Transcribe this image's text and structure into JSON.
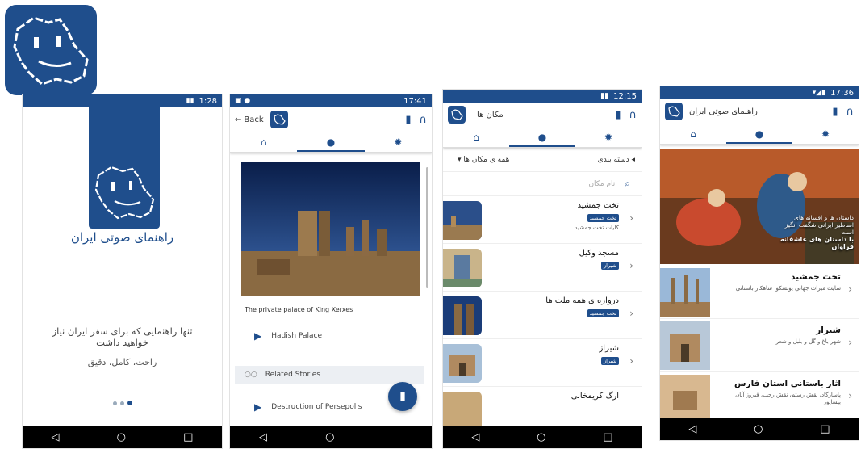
{
  "screen1": {
    "time": "1:28",
    "title": "راهنمای صوتی ایران",
    "subtitle": "تنها راهنمایی که برای سفر ایران نیاز خواهید داشت",
    "tagline": "راحت، کامل، دقیق"
  },
  "screen2": {
    "time": "17:41",
    "back_label": "Back",
    "caption": "The private palace of King Xerxes",
    "audio1": "Hadish Palace",
    "related_label": "Related Stories",
    "audio2": "Destruction of Persepolis"
  },
  "screen3": {
    "time": "12:15",
    "title": "مکان ها",
    "category_label": "دسته بندی",
    "all_places": "همه ی مکان ها",
    "search_placeholder": "نام مکان",
    "items": [
      {
        "name": "تخت جمشید",
        "badge": "تخت جمشید",
        "desc": "کلیات تخت جمشید"
      },
      {
        "name": "مسجد وکیل",
        "badge": "شیراز",
        "desc": ""
      },
      {
        "name": "دروازه ی همه ملت ها",
        "badge": "تخت جمشید",
        "desc": ""
      },
      {
        "name": "شیراز",
        "badge": "شیراز",
        "desc": ""
      },
      {
        "name": "ارگ کریمخانی",
        "badge": "",
        "desc": ""
      }
    ]
  },
  "screen4": {
    "time": "17:36",
    "title": "راهنمای صوتی ایران",
    "banner_line1": "داستان ها و افسانه های",
    "banner_line2": "اساطیر ایرانی شگفت انگیز",
    "banner_line3": "است",
    "banner_line4": "با داستان های عاشقانه فراوان",
    "items": [
      {
        "name": "تخت جمشید",
        "desc": "سایت میراث جهانی یونسکو، شاهکار باستانی"
      },
      {
        "name": "شیراز",
        "desc": "شهر باغ و گل و بلبل و شعر"
      },
      {
        "name": "اثار باستانی استان فارس",
        "desc": "پاسارگاد، نقش رستم، نقش رجب، فیروز آباد، بیشاپور"
      }
    ]
  },
  "colors": {
    "brand": "#1f4e8c"
  }
}
